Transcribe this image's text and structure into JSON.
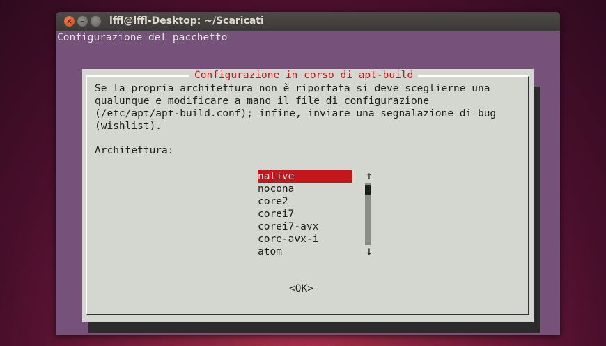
{
  "window": {
    "title": "lffl@lffl-Desktop: ~/Scaricati",
    "buttons": {
      "close": "×",
      "minimize": "–",
      "maximize": ""
    }
  },
  "terminal": {
    "header": "Configurazione del pacchetto"
  },
  "dialog": {
    "title": "Configurazione in corso di apt-build",
    "body_lines": [
      "Se la propria architettura non è riportata si deve sceglierne una",
      "qualunque e modificare a mano il file di configurazione",
      "(/etc/apt/apt-build.conf); infine, inviare una segnalazione di bug",
      "(wishlist)."
    ],
    "prompt": "Architettura:",
    "options": [
      "native",
      "nocona",
      "core2",
      "corei7",
      "corei7-avx",
      "core-avx-i",
      "atom"
    ],
    "selected": "native",
    "scroll_up": "↑",
    "scroll_down": "↓",
    "ok_label": "<OK>"
  },
  "colors": {
    "terminal_bg": "#76527a",
    "dialog_bg": "#d3d7cf",
    "accent_red": "#c4161b"
  }
}
